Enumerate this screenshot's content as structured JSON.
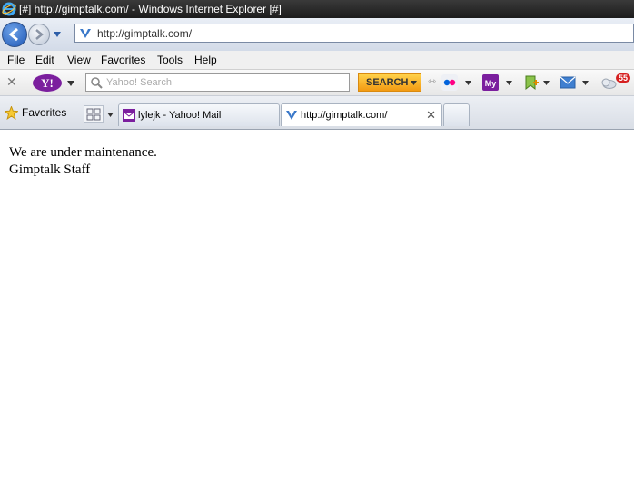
{
  "window": {
    "title": "[#] http://gimptalk.com/ - Windows Internet Explorer [#]"
  },
  "address_bar": {
    "url": "http://gimptalk.com/"
  },
  "menu": {
    "items": [
      "File",
      "Edit",
      "View",
      "Favorites",
      "Tools",
      "Help"
    ]
  },
  "yahoo_toolbar": {
    "logo_text": "Y!",
    "search_placeholder": "Yahoo! Search",
    "search_button_label": "SEARCH",
    "mail_badge_count": "55"
  },
  "favorites_bar": {
    "favorites_label": "Favorites"
  },
  "tabs": [
    {
      "label": "lylejk - Yahoo! Mail",
      "active": false
    },
    {
      "label": "http://gimptalk.com/",
      "active": true
    }
  ],
  "page": {
    "line1": "We are under maintenance.",
    "line2": "Gimptalk Staff"
  },
  "colors": {
    "yahoo_purple": "#7b1f9e",
    "search_orange": "#f39a12",
    "title_bar": "#1c1c1c"
  }
}
